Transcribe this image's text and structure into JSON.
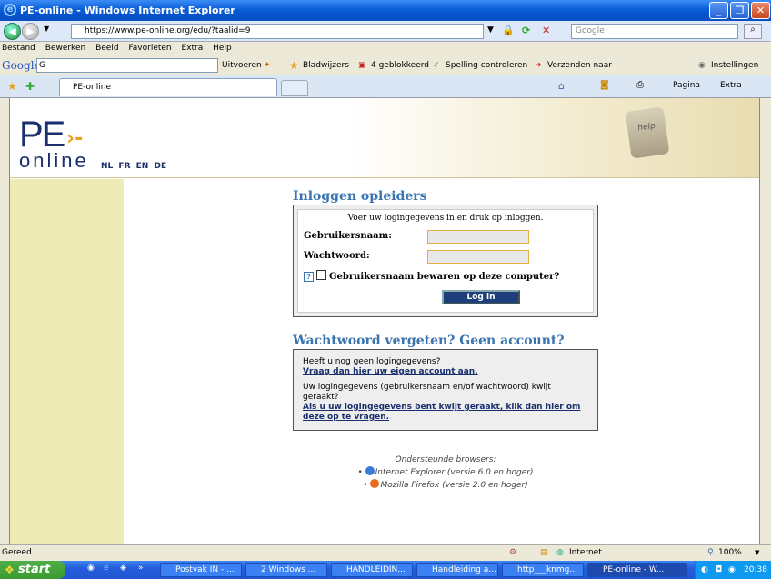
{
  "window": {
    "title": "PE-online - Windows Internet Explorer"
  },
  "address": {
    "url": "https://www.pe-online.org/edu/?taalid=9",
    "search_placeholder": "Google"
  },
  "menu": [
    "Bestand",
    "Bewerken",
    "Beeld",
    "Favorieten",
    "Extra",
    "Help"
  ],
  "google_toolbar": {
    "brand": "Google",
    "search_value": "G",
    "go_label": "Uitvoeren",
    "bookmarks": "Bladwijzers",
    "blocked": "4 geblokkeerd",
    "spelling": "Spelling controleren",
    "send": "Verzenden naar",
    "settings": "Instellingen"
  },
  "tab": {
    "label": "PE-online"
  },
  "command_bar": {
    "page": "Pagina",
    "tools": "Extra"
  },
  "site": {
    "logo_top": "PE",
    "logo_bottom": "online",
    "languages": [
      "NL",
      "FR",
      "EN",
      "DE"
    ],
    "help_key": "help"
  },
  "login": {
    "heading": "Inloggen opleiders",
    "intro": "Voer uw logingegevens in en druk op inloggen.",
    "username_label": "Gebruikersnaam:",
    "password_label": "Wachtwoord:",
    "remember_label": "Gebruikersnaam bewaren op deze computer?",
    "help_mark": "?",
    "button": "Log in"
  },
  "forgot": {
    "heading": "Wachtwoord vergeten? Geen account?",
    "no_account_text": "Heeft u nog geen logingegevens?",
    "no_account_link": "Vraag dan hier uw eigen account aan.",
    "lost_text": "Uw logingegevens (gebruikersnaam en/of wachtwoord) kwijt geraakt?",
    "lost_link": "Als u uw logingegevens bent kwijt geraakt, klik dan hier om deze op te vragen."
  },
  "browsers": {
    "title": "Ondersteunde browsers:",
    "items": [
      "Internet Explorer (versie 6.0 en hoger)",
      "Mozilla Firefox (versie 2.0 en hoger)"
    ]
  },
  "status": {
    "left": "Gereed",
    "zone": "Internet",
    "zoom": "100%"
  },
  "taskbar": {
    "start": "start",
    "tasks": [
      "Postvak IN - ...",
      "2 Windows ...",
      "HANDLEIDIN...",
      "Handleiding a...",
      "http___knmg...",
      "PE-online - W..."
    ],
    "clock": "20:38"
  }
}
